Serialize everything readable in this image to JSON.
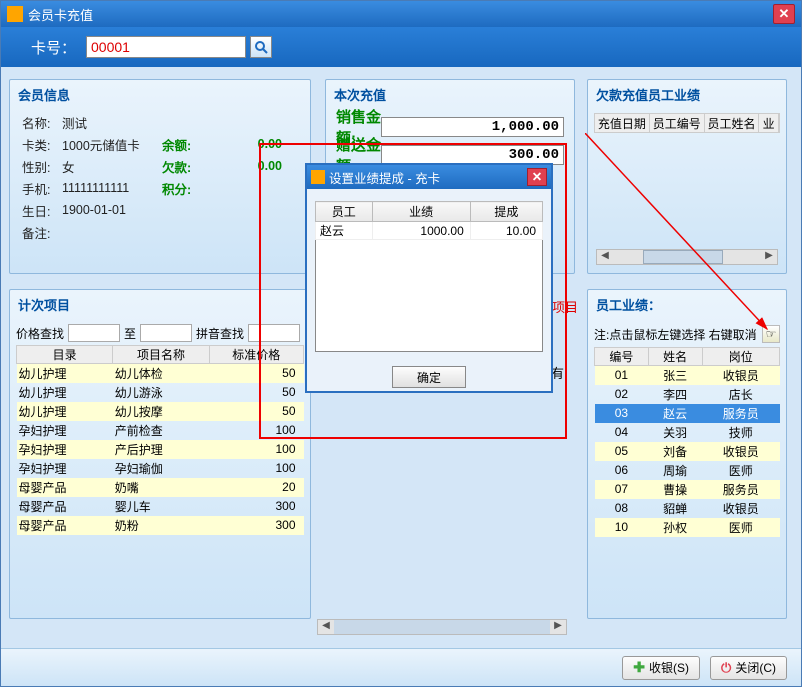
{
  "window": {
    "title": "会员卡充值"
  },
  "cardRow": {
    "label": "卡号：",
    "value": "00001"
  },
  "memberPanel": {
    "title": "会员信息",
    "rows": [
      {
        "k": "名称:",
        "v": "测试"
      },
      {
        "k": "卡类:",
        "v": "1000元储值卡"
      },
      {
        "k": "性别:",
        "v": "女"
      },
      {
        "k": "手机:",
        "v": "11111111111"
      },
      {
        "k": "生日:",
        "v": "1900-01-01"
      },
      {
        "k": "备注:",
        "v": ""
      }
    ],
    "extras": [
      {
        "k": "余额:",
        "v": "0.00"
      },
      {
        "k": "欠款:",
        "v": "0.00"
      },
      {
        "k": "积分:",
        "v": ""
      }
    ]
  },
  "rechargePanel": {
    "title": "本次充值",
    "rows": [
      {
        "label": "销售金额:",
        "value": "1,000.00"
      },
      {
        "label": "赠送金额:",
        "value": "300.00"
      }
    ]
  },
  "owedPanel": {
    "title": "欠款充值员工业绩",
    "headers": [
      "充值日期",
      "员工编号",
      "员工姓名",
      "业"
    ]
  },
  "countPanel": {
    "title": "计次项目",
    "search": {
      "priceLabel": "价格查找",
      "to": "至",
      "pinyinLabel": "拼音查找"
    },
    "headers": [
      "目录",
      "项目名称",
      "标准价格"
    ],
    "rows": [
      {
        "dir": "幼儿护理",
        "name": "幼儿体检",
        "price": "50"
      },
      {
        "dir": "幼儿护理",
        "name": "幼儿游泳",
        "price": "50"
      },
      {
        "dir": "幼儿护理",
        "name": "幼儿按摩",
        "price": "50"
      },
      {
        "dir": "孕妇护理",
        "name": "产前检查",
        "price": "100"
      },
      {
        "dir": "孕妇护理",
        "name": "产后护理",
        "price": "100"
      },
      {
        "dir": "孕妇护理",
        "name": "孕妇瑜伽",
        "price": "100"
      },
      {
        "dir": "母婴产品",
        "name": "奶嘴",
        "price": "20"
      },
      {
        "dir": "母婴产品",
        "name": "婴儿车",
        "price": "300"
      },
      {
        "dir": "母婴产品",
        "name": "奶粉",
        "price": "300"
      }
    ]
  },
  "midText1": "次项目",
  "midText2": "有",
  "empPanel": {
    "title": "员工业绩：",
    "note": "注:点击鼠标左键选择 右键取消",
    "headers": [
      "编号",
      "姓名",
      "岗位"
    ],
    "rows": [
      {
        "no": "01",
        "name": "张三",
        "pos": "收银员",
        "sel": false
      },
      {
        "no": "02",
        "name": "李四",
        "pos": "店长",
        "sel": false
      },
      {
        "no": "03",
        "name": "赵云",
        "pos": "服务员",
        "sel": true
      },
      {
        "no": "04",
        "name": "关羽",
        "pos": "技师",
        "sel": false
      },
      {
        "no": "05",
        "name": "刘备",
        "pos": "收银员",
        "sel": false
      },
      {
        "no": "06",
        "name": "周瑜",
        "pos": "医师",
        "sel": false
      },
      {
        "no": "07",
        "name": "曹操",
        "pos": "服务员",
        "sel": false
      },
      {
        "no": "08",
        "name": "貂蝉",
        "pos": "收银员",
        "sel": false
      },
      {
        "no": "10",
        "name": "孙权",
        "pos": "医师",
        "sel": false
      }
    ]
  },
  "modal": {
    "title": "设置业绩提成 - 充卡",
    "headers": [
      "员工",
      "业绩",
      "提成"
    ],
    "rows": [
      {
        "emp": "赵云",
        "perf": "1000.00",
        "comm": "10.00"
      }
    ],
    "confirm": "确定"
  },
  "footer": {
    "checkout": "收银(S)",
    "close": "关闭(C)"
  }
}
